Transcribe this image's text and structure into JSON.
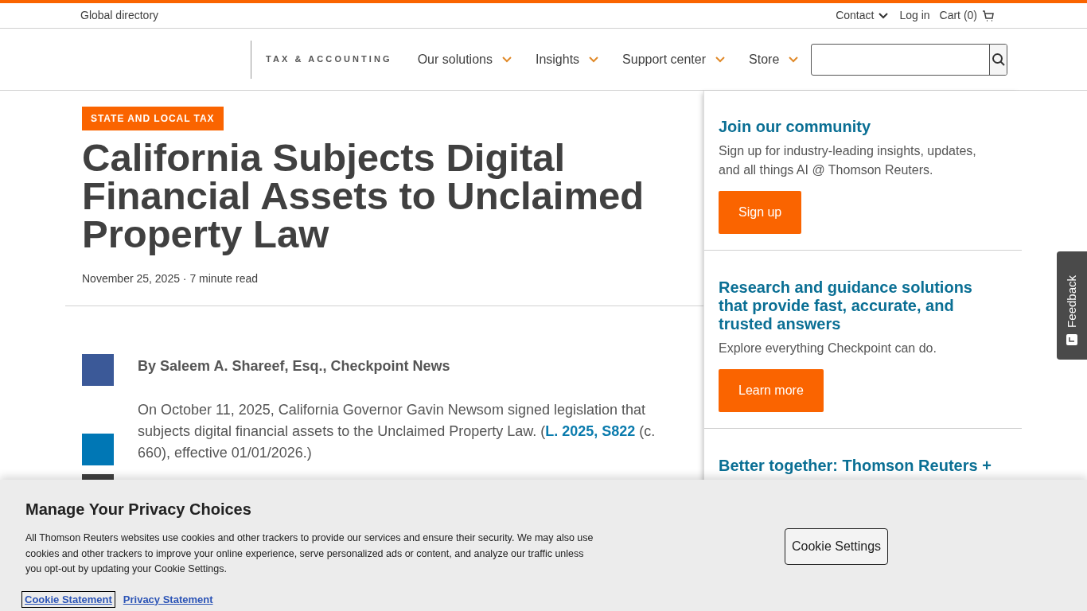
{
  "utility_bar": {
    "left_link": "Global directory",
    "links": [
      {
        "label": "Contact",
        "dropdown": true
      },
      {
        "label": "Log in",
        "dropdown": false
      }
    ],
    "cart": "Cart (0)"
  },
  "nav": {
    "brand": "TAX & ACCOUNTING",
    "items": [
      "Our solutions",
      "Insights",
      "Support center",
      "Store"
    ]
  },
  "article": {
    "category": "STATE AND LOCAL TAX",
    "title": "California Subjects Digital Financial Assets to Unclaimed Property Law",
    "meta": "November 25, 2025 · 7 minute read",
    "byline": "By Saleem A. Shareef, Esq., Checkpoint News",
    "paragraph_before": "On October 11, 2025, California Governor Gavin Newsom signed legislation that subjects digital financial assets to the Unclaimed Property Law. (",
    "paragraph_link": "L. 2025, S822",
    "paragraph_after": " (c. 660), effective 01/01/2026.)",
    "share": [
      {
        "color": "#3b5998"
      },
      {
        "color": "#0077b5"
      },
      {
        "color": "#404040"
      }
    ]
  },
  "sidebar": [
    {
      "title": "Join our community",
      "text": "Sign up for industry-leading insights, updates, and all things AI @ Thomson Reuters.",
      "button": "Sign up"
    },
    {
      "title": "Research and guidance solutions that provide fast, accurate, and trusted answers",
      "text": "Explore everything Checkpoint can do.",
      "button": "Learn more"
    },
    {
      "title": "Better together: Thomson Reuters +"
    }
  ],
  "feedback": "Feedback",
  "cookie_banner": {
    "title": "Manage Your Privacy Choices",
    "text": "All Thomson Reuters websites use cookies and other trackers to provide our services and ensure their security. We may also use cookies and other trackers to improve your online experience, serve personalized ads or content, and analyze our traffic unless you opt-out by updating your Cookie Settings.",
    "links": [
      {
        "label": "Cookie Statement",
        "selected": true
      },
      {
        "label": "Privacy Statement",
        "selected": false
      }
    ],
    "button": "Cookie Settings"
  }
}
